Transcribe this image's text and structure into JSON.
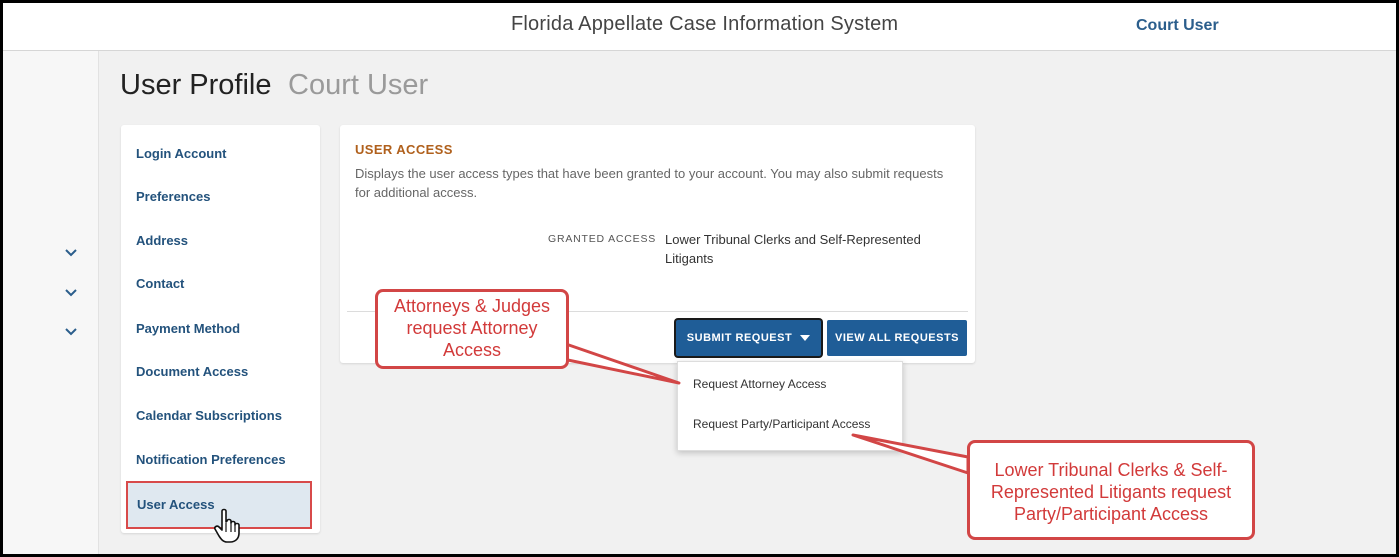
{
  "header": {
    "app_title": "Florida Appellate Case Information System",
    "user_name": "Court User"
  },
  "page": {
    "title": "User Profile",
    "subtitle": "Court User"
  },
  "sidebar": {
    "items": [
      {
        "label": "Login Account"
      },
      {
        "label": "Preferences"
      },
      {
        "label": "Address"
      },
      {
        "label": "Contact"
      },
      {
        "label": "Payment Method"
      },
      {
        "label": "Document Access"
      },
      {
        "label": "Calendar Subscriptions"
      },
      {
        "label": "Notification Preferences"
      },
      {
        "label": "User Access",
        "active": true
      }
    ]
  },
  "user_access": {
    "heading": "USER ACCESS",
    "description": "Displays the user access types that have been granted to your account. You may also submit requests for additional access.",
    "granted_label": "GRANTED ACCESS",
    "granted_value": "Lower Tribunal Clerks and Self-Represented Litigants",
    "submit_label": "SUBMIT REQUEST",
    "view_all_label": "VIEW ALL REQUESTS"
  },
  "dropdown": {
    "items": [
      {
        "label": "Request Attorney Access"
      },
      {
        "label": "Request Party/Participant Access"
      }
    ]
  },
  "callouts": {
    "attorney": "Attorneys & Judges request Attorney Access",
    "party": "Lower Tribunal Clerks & Self-Represented Litigants request Party/Participant Access"
  },
  "icons": {
    "rail": [
      "chevron-down-icon",
      "chevron-down-icon",
      "chevron-down-icon"
    ],
    "submit_caret": "caret-down-icon",
    "cursor": "hand-pointer-icon"
  },
  "colors": {
    "accent_blue": "#1f5d97",
    "link_blue": "#23527c",
    "heading_orange": "#b0601c",
    "callout_red": "#d24646"
  }
}
